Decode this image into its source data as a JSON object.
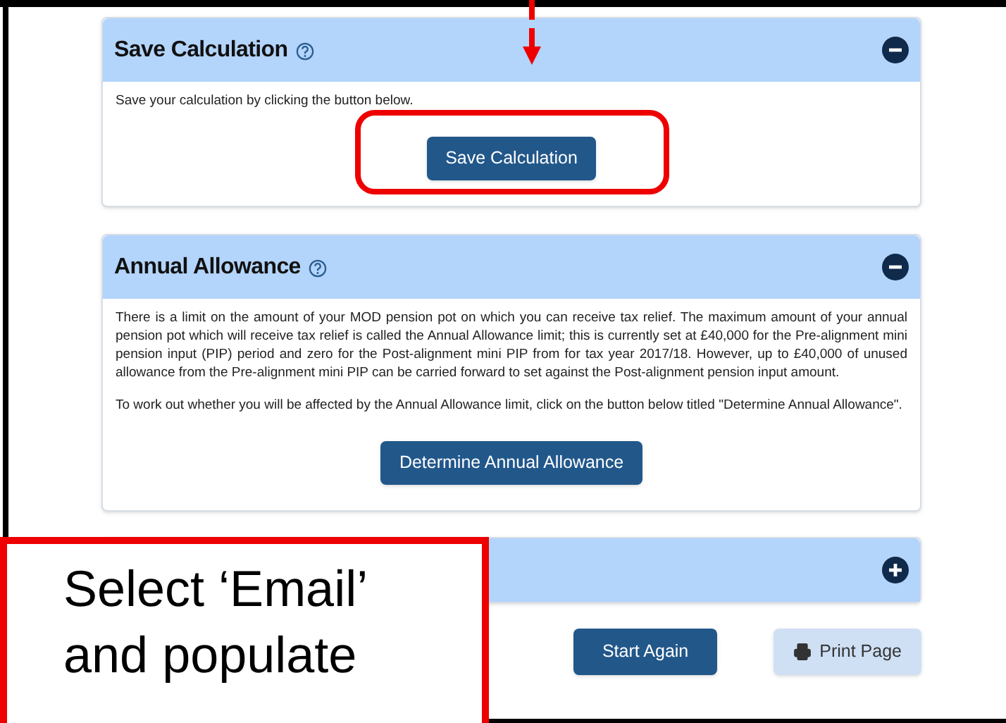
{
  "panels": [
    {
      "title": "Save Calculation",
      "expanded": true,
      "paragraphs": [
        "Save your calculation by clicking the button below."
      ],
      "button": "Save Calculation"
    },
    {
      "title": "Annual Allowance",
      "expanded": true,
      "paragraphs": [
        "There is a limit on the amount of your MOD pension pot on which you can receive tax relief. The maximum amount of your annual pension pot which will receive tax relief is called the Annual Allowance limit; this is currently set at £40,000 for the Pre-alignment mini pension input (PIP) period and zero for the Post-alignment mini PIP from for tax year 2017/18. However, up to £40,000 of unused allowance from the Pre-alignment mini PIP can be carried forward to set against the Post-alignment pension input amount.",
        "To work out whether you will be affected by the Annual Allowance limit, click on the button below titled \"Determine Annual Allowance\"."
      ],
      "button": "Determine Annual Allowance"
    },
    {
      "expanded": false
    }
  ],
  "actions": [
    {
      "label": "Start Again",
      "kind": "primary"
    },
    {
      "label": "Print Page",
      "kind": "print"
    }
  ],
  "callout": {
    "lines": [
      "Select ‘Email’",
      "and populate"
    ]
  }
}
